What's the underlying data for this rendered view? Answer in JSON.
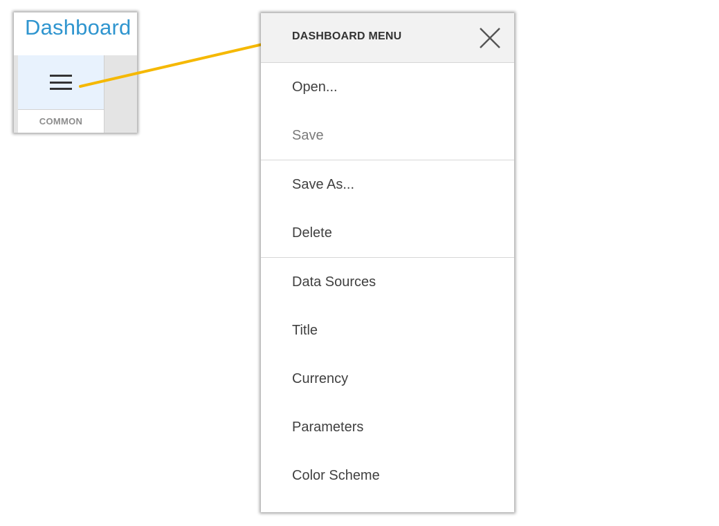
{
  "inset": {
    "title": "Dashboard",
    "group_label": "COMMON",
    "menu_button_icon": "hamburger-menu-icon"
  },
  "panel": {
    "title": "DASHBOARD MENU",
    "close_icon": "close-icon",
    "items": [
      {
        "label": "Open...",
        "enabled": true
      },
      {
        "label": "Save",
        "enabled": false
      },
      {
        "label": "Save As...",
        "enabled": true
      },
      {
        "label": "Delete",
        "enabled": true
      },
      {
        "label": "Data Sources",
        "enabled": true
      },
      {
        "label": "Title",
        "enabled": true
      },
      {
        "label": "Currency",
        "enabled": true
      },
      {
        "label": "Parameters",
        "enabled": true
      },
      {
        "label": "Color Scheme",
        "enabled": true
      }
    ]
  },
  "colors": {
    "accent_blue": "#2f95cf",
    "arrow_yellow": "#f5b800",
    "active_button_bg": "#e8f2fd"
  }
}
